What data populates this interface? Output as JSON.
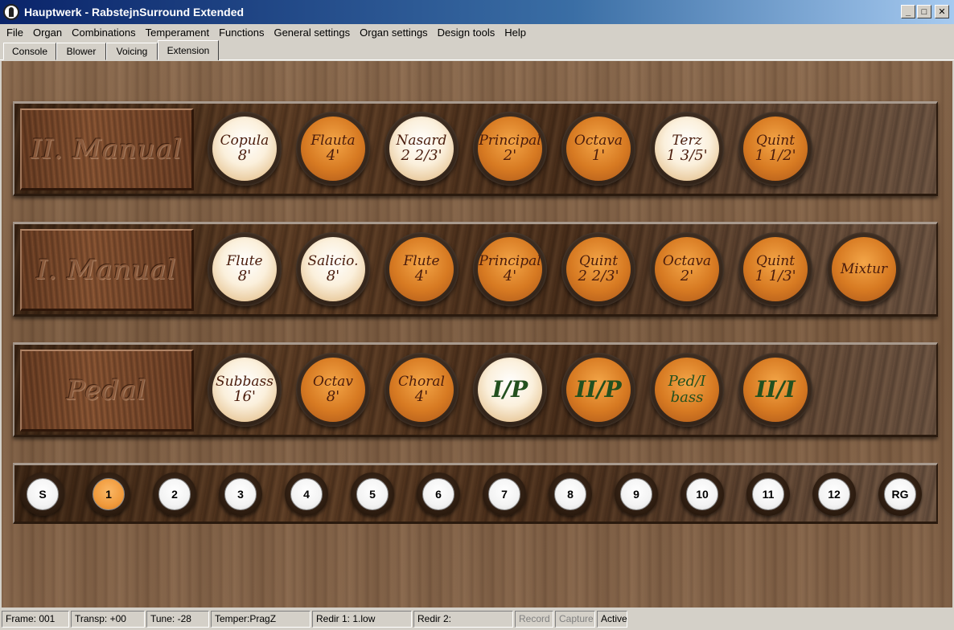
{
  "window": {
    "title": "Hauptwerk - RabstejnSurround Extended",
    "min_label": "_",
    "max_label": "□",
    "close_label": "✕"
  },
  "menu": [
    "File",
    "Organ",
    "Combinations",
    "Temperament",
    "Functions",
    "General settings",
    "Organ settings",
    "Design tools",
    "Help"
  ],
  "tabs": [
    "Console",
    "Blower",
    "Voicing",
    "Extension"
  ],
  "active_tab": "Extension",
  "divisions": [
    {
      "label": "II. Manual",
      "stops": [
        {
          "name": "Copula",
          "size": "8'",
          "on": true
        },
        {
          "name": "Flauta",
          "size": "4'",
          "on": false
        },
        {
          "name": "Nasard",
          "size": "2 2/3'",
          "on": true
        },
        {
          "name": "Principal",
          "size": "2'",
          "on": false
        },
        {
          "name": "Octava",
          "size": "1'",
          "on": false
        },
        {
          "name": "Terz",
          "size": "1 3/5'",
          "on": true
        },
        {
          "name": "Quint",
          "size": "1 1/2'",
          "on": false
        }
      ]
    },
    {
      "label": "I. Manual",
      "stops": [
        {
          "name": "Flute",
          "size": "8'",
          "on": true
        },
        {
          "name": "Salicio.",
          "size": "8'",
          "on": true
        },
        {
          "name": "Flute",
          "size": "4'",
          "on": false
        },
        {
          "name": "Principal",
          "size": "4'",
          "on": false
        },
        {
          "name": "Quint",
          "size": "2 2/3'",
          "on": false
        },
        {
          "name": "Octava",
          "size": "2'",
          "on": false
        },
        {
          "name": "Quint",
          "size": "1 1/3'",
          "on": false
        },
        {
          "name": "Mixtur",
          "size": "",
          "on": false
        }
      ]
    },
    {
      "label": "Pedal",
      "stops": [
        {
          "name": "Subbass",
          "size": "16'",
          "on": true
        },
        {
          "name": "Octav",
          "size": "8'",
          "on": false
        },
        {
          "name": "Choral",
          "size": "4'",
          "on": false
        },
        {
          "name": "I/P",
          "size": "",
          "on": true,
          "coupler": true
        },
        {
          "name": "II/P",
          "size": "",
          "on": false,
          "coupler": true
        },
        {
          "name": "Ped/I",
          "size": "bass",
          "on": false,
          "coupler2": true
        },
        {
          "name": "II/I",
          "size": "",
          "on": false,
          "coupler": true
        }
      ]
    }
  ],
  "pistons": [
    "S",
    "1",
    "2",
    "3",
    "4",
    "5",
    "6",
    "7",
    "8",
    "9",
    "10",
    "11",
    "12",
    "RG"
  ],
  "active_piston": "1",
  "status": [
    {
      "text": "Frame: 001",
      "disabled": false
    },
    {
      "text": "Transp: +00",
      "disabled": false
    },
    {
      "text": "Tune: -28",
      "disabled": false
    },
    {
      "text": "Temper:PragZ",
      "disabled": false
    },
    {
      "text": "Redir 1: 1.low",
      "disabled": false
    },
    {
      "text": "Redir 2:",
      "disabled": false
    },
    {
      "text": "Record",
      "disabled": true
    },
    {
      "text": "Capture",
      "disabled": true
    },
    {
      "text": "Active",
      "disabled": false
    }
  ]
}
